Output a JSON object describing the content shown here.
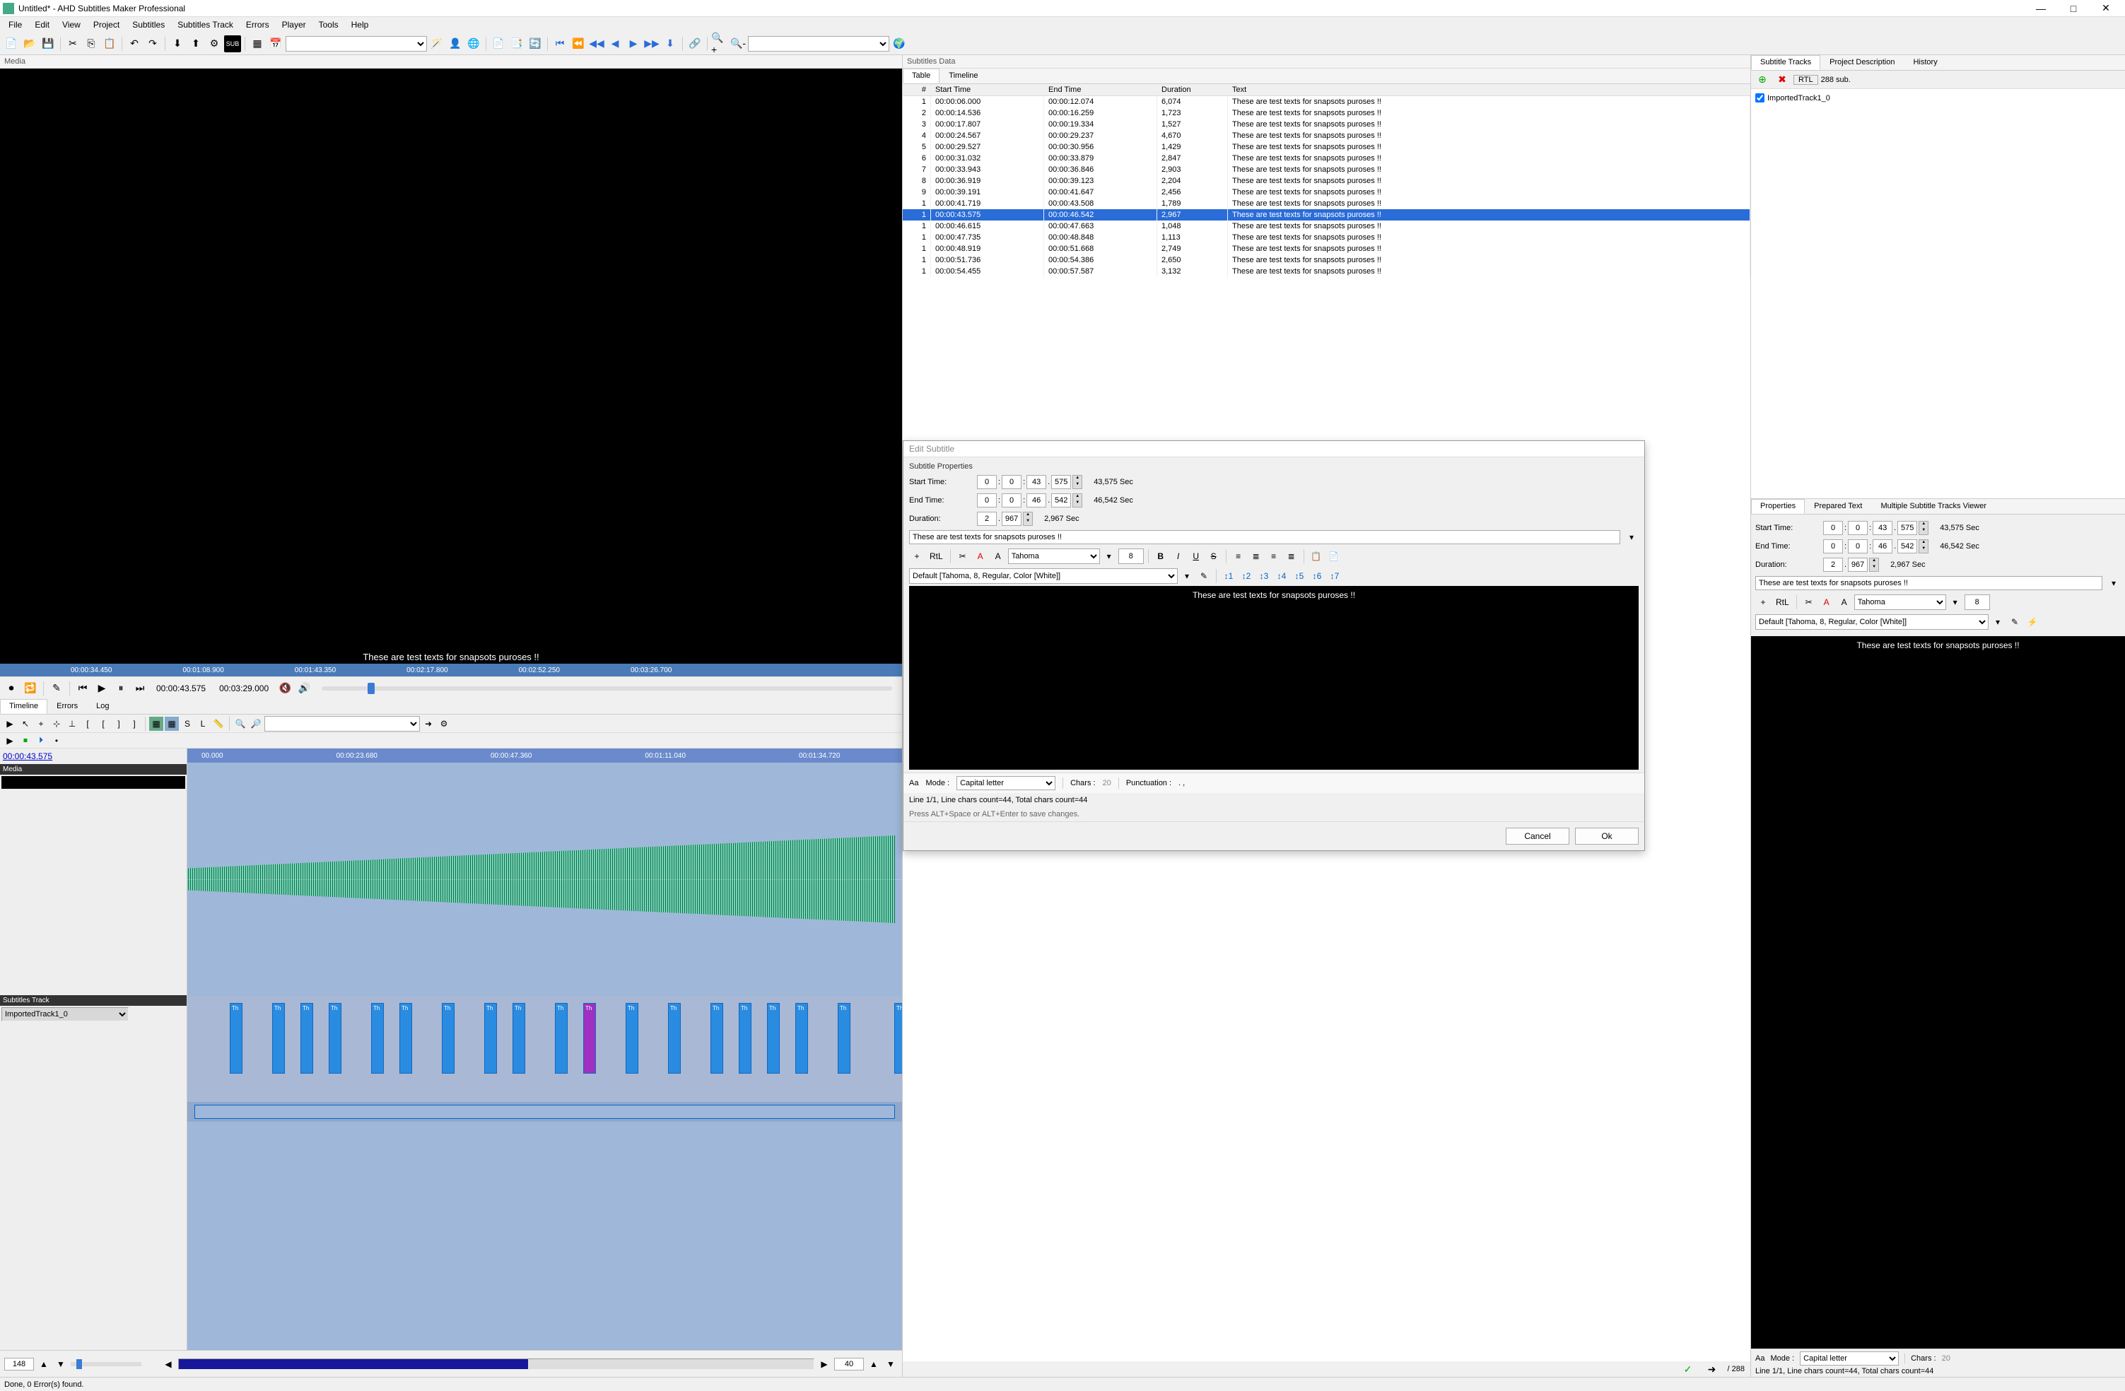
{
  "window": {
    "title": "Untitled* - AHD Subtitles Maker Professional",
    "minimize": "—",
    "maximize": "□",
    "close": "✕"
  },
  "menu": [
    "File",
    "Edit",
    "View",
    "Project",
    "Subtitles",
    "Subtitles Track",
    "Errors",
    "Player",
    "Tools",
    "Help"
  ],
  "panels": {
    "media": "Media",
    "subtitles_data": "Subtitles Data",
    "subtitle_tracks": "Subtitle Tracks",
    "project_description": "Project Description",
    "history": "History",
    "properties": "Properties",
    "prepared_text": "Prepared Text",
    "multi_viewer": "Multiple Subtitle Tracks Viewer",
    "timeline": "Timeline",
    "errors": "Errors",
    "log": "Log",
    "subtitles_track": "Subtitles Track"
  },
  "media": {
    "overlay": "These are test texts for snapsots puroses !!",
    "ruler_times": [
      "00:00:34.450",
      "00:01:08.900",
      "00:01:43.350",
      "00:02:17.800",
      "00:02:52.250",
      "00:03:26.700"
    ],
    "current_time": "00:00:43.575",
    "total_time": "00:03:29.000"
  },
  "subtabs": {
    "table": "Table",
    "timeline": "Timeline"
  },
  "table": {
    "headers": {
      "idx": "#",
      "start": "Start Time",
      "end": "End Time",
      "dur": "Duration",
      "text": "Text"
    },
    "rows": [
      {
        "i": 1,
        "st": "00:00:06.000",
        "et": "00:00:12.074",
        "du": "6,074",
        "tx": "These are test texts for snapsots puroses !!"
      },
      {
        "i": 2,
        "st": "00:00:14.536",
        "et": "00:00:16.259",
        "du": "1,723",
        "tx": "These are test texts for snapsots puroses !!"
      },
      {
        "i": 3,
        "st": "00:00:17.807",
        "et": "00:00:19.334",
        "du": "1,527",
        "tx": "These are test texts for snapsots puroses !!"
      },
      {
        "i": 4,
        "st": "00:00:24.567",
        "et": "00:00:29.237",
        "du": "4,670",
        "tx": "These are test texts for snapsots puroses !!"
      },
      {
        "i": 5,
        "st": "00:00:29.527",
        "et": "00:00:30.956",
        "du": "1,429",
        "tx": "These are test texts for snapsots puroses !!"
      },
      {
        "i": 6,
        "st": "00:00:31.032",
        "et": "00:00:33.879",
        "du": "2,847",
        "tx": "These are test texts for snapsots puroses !!"
      },
      {
        "i": 7,
        "st": "00:00:33.943",
        "et": "00:00:36.846",
        "du": "2,903",
        "tx": "These are test texts for snapsots puroses !!"
      },
      {
        "i": 8,
        "st": "00:00:36.919",
        "et": "00:00:39.123",
        "du": "2,204",
        "tx": "These are test texts for snapsots puroses !!"
      },
      {
        "i": 9,
        "st": "00:00:39.191",
        "et": "00:00:41.647",
        "du": "2,456",
        "tx": "These are test texts for snapsots puroses !!"
      },
      {
        "i": 1,
        "st": "00:00:41.719",
        "et": "00:00:43.508",
        "du": "1,789",
        "tx": "These are test texts for snapsots puroses !!"
      },
      {
        "i": 1,
        "st": "00:00:43.575",
        "et": "00:00:46.542",
        "du": "2,967",
        "tx": "These are test texts for snapsots puroses !!",
        "sel": true
      },
      {
        "i": 1,
        "st": "00:00:46.615",
        "et": "00:00:47.663",
        "du": "1,048",
        "tx": "These are test texts for snapsots puroses !!"
      },
      {
        "i": 1,
        "st": "00:00:47.735",
        "et": "00:00:48.848",
        "du": "1,113",
        "tx": "These are test texts for snapsots puroses !!"
      },
      {
        "i": 1,
        "st": "00:00:48.919",
        "et": "00:00:51.668",
        "du": "2,749",
        "tx": "These are test texts for snapsots puroses !!"
      },
      {
        "i": 1,
        "st": "00:00:51.736",
        "et": "00:00:54.386",
        "du": "2,650",
        "tx": "These are test texts for snapsots puroses !!"
      },
      {
        "i": 1,
        "st": "00:00:54.455",
        "et": "00:00:57.587",
        "du": "3,132",
        "tx": "These are test texts for snapsots puroses !!"
      }
    ],
    "total_count": "/ 288"
  },
  "modal": {
    "title": "Edit Subtitle",
    "group": "Subtitle Properties",
    "start_label": "Start Time:",
    "start": {
      "h": "0",
      "m": "0",
      "s": "43",
      "ms": "575",
      "sec": "43,575 Sec"
    },
    "end_label": "End Time:",
    "end": {
      "h": "0",
      "m": "0",
      "s": "46",
      "ms": "542",
      "sec": "46,542 Sec"
    },
    "dur_label": "Duration:",
    "dur": {
      "s": "2",
      "ms": "967",
      "sec": "2,967 Sec"
    },
    "text": "These are test texts for snapsots puroses !!",
    "rtl": "RtL",
    "font": "Tahoma",
    "font_size": "8",
    "style": "Default [Tahoma, 8, Regular, Color [White]]",
    "preview": "These are test texts for snapsots puroses !!",
    "mode_label": "Mode :",
    "mode": "Capital letter",
    "chars_label": "Chars :",
    "chars": "20",
    "punct_label": "Punctuation :",
    "punct": ". ,",
    "line_info": "Line 1/1, Line chars count=44, Total chars count=44",
    "help": "Press ALT+Space or ALT+Enter to save changes.",
    "cancel": "Cancel",
    "ok": "Ok"
  },
  "tracks": {
    "rtl_btn": "RTL",
    "sub_count": "288 sub.",
    "items": [
      {
        "name": "ImportedTrack1_0",
        "checked": true
      }
    ]
  },
  "props": {
    "start_label": "Start Time:",
    "start": {
      "h": "0",
      "m": "0",
      "s": "43",
      "ms": "575",
      "sec": "43,575 Sec"
    },
    "end_label": "End Time:",
    "end": {
      "h": "0",
      "m": "0",
      "s": "46",
      "ms": "542",
      "sec": "46,542 Sec"
    },
    "dur_label": "Duration:",
    "dur": {
      "s": "2",
      "ms": "967",
      "sec": "2,967 Sec"
    },
    "text": "These are test texts for snapsots puroses !!",
    "rtl": "RtL",
    "font": "Tahoma",
    "font_size": "8",
    "style": "Default [Tahoma, 8, Regular, Color [White]]",
    "preview": "These are test texts for snapsots puroses !!",
    "mode_label": "Mode :",
    "mode": "Capital letter",
    "chars_label": "Chars :",
    "chars": "20",
    "line_info": "Line 1/1, Line chars count=44, Total chars count=44"
  },
  "timeline": {
    "time_link": "00:00:43.575",
    "media_head": "Media",
    "track_combo": "ImportedTrack1_0",
    "ruler": [
      "00.000",
      "00:00:23.680",
      "00:00:47.360",
      "00:01:11.040",
      "00:01:34.720"
    ],
    "zoom_val": "148",
    "right_zoom": "40"
  },
  "status": "Done, 0 Error(s) found."
}
